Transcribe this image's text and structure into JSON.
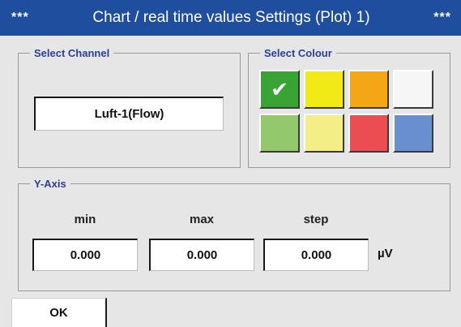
{
  "window": {
    "stars_left": "***",
    "title": "Chart / real time values Settings (Plot) 1)",
    "stars_right": "***"
  },
  "channel": {
    "legend": "Select Channel",
    "value": "Luft-1(Flow)"
  },
  "colour": {
    "legend": "Select Colour",
    "selected_index": 0,
    "swatches": [
      {
        "color": "#3aa335",
        "selected": true
      },
      {
        "color": "#f2ea16",
        "selected": false
      },
      {
        "color": "#f3a714",
        "selected": false
      },
      {
        "color": "#f6f6f6",
        "selected": false
      },
      {
        "color": "#93c96c",
        "selected": false
      },
      {
        "color": "#f3ef86",
        "selected": false
      },
      {
        "color": "#ea4d52",
        "selected": false
      },
      {
        "color": "#6a8fd0",
        "selected": false
      }
    ]
  },
  "yaxis": {
    "legend": "Y-Axis",
    "min_label": "min",
    "max_label": "max",
    "step_label": "step",
    "min_value": "0.000",
    "max_value": "0.000",
    "step_value": "0.000",
    "unit": "µV"
  },
  "footer": {
    "ok_label": "OK"
  }
}
